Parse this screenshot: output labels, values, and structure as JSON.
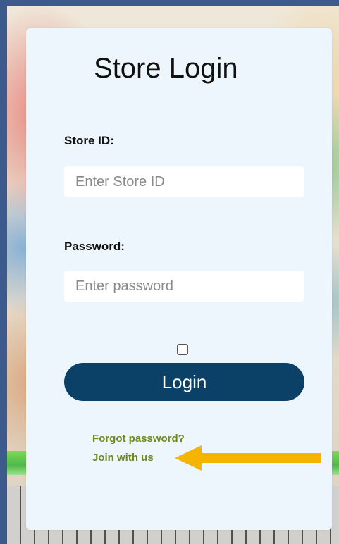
{
  "login": {
    "title": "Store Login",
    "store_id_label": "Store ID:",
    "store_id_placeholder": "Enter Store ID",
    "password_label": "Password:",
    "password_placeholder": "Enter password",
    "remember_checked": false,
    "login_button": "Login",
    "forgot_password_link": "Forgot password?",
    "join_link": "Join with us"
  },
  "annotation": {
    "arrow_icon": "left-arrow-icon",
    "arrow_color": "#f5b400"
  },
  "colors": {
    "frame": "#3d5a8c",
    "card": "#eef6fd",
    "button": "#0b4166",
    "link": "#6b8a1f"
  }
}
